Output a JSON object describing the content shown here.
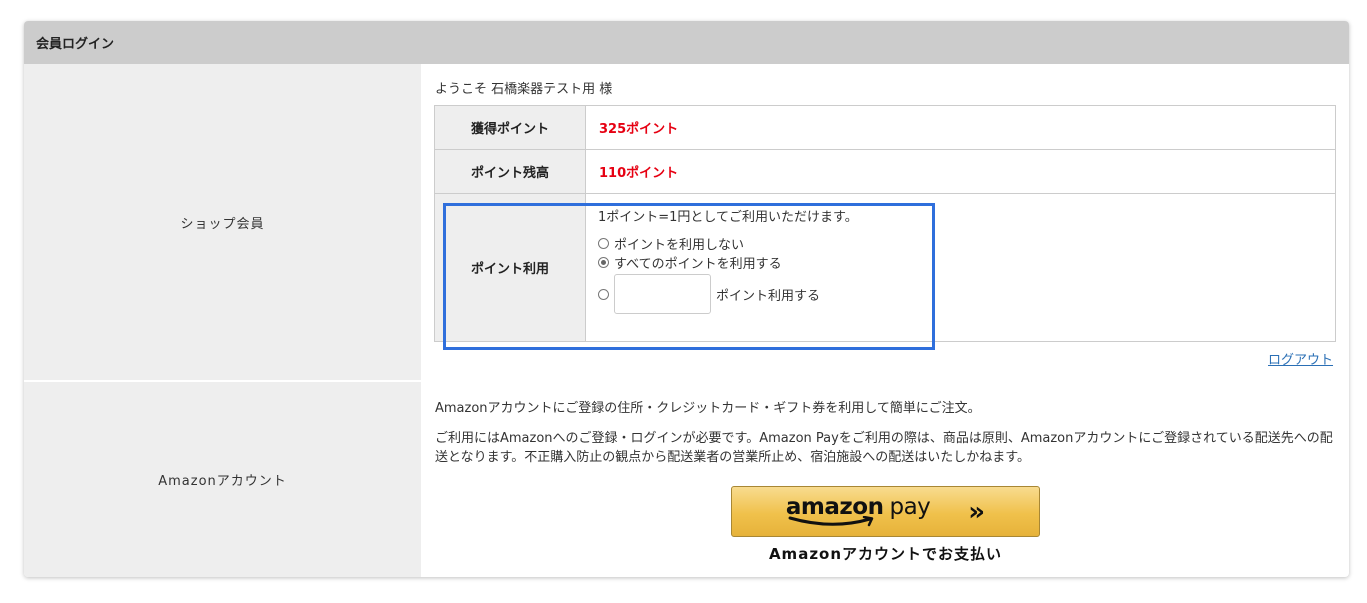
{
  "header": {
    "title": "会員ログイン"
  },
  "shop_member": {
    "label": "ショップ会員",
    "welcome": "ようこそ 石橋楽器テスト用 様",
    "earned_points_label": "獲得ポイント",
    "earned_points_value": "325ポイント",
    "balance_label": "ポイント残高",
    "balance_value": "110ポイント",
    "use_label": "ポイント利用",
    "use_note": "1ポイント=1円としてご利用いただけます。",
    "options": [
      {
        "label": "ポイントを利用しない",
        "checked": false
      },
      {
        "label": "すべてのポイントを利用する",
        "checked": true
      },
      {
        "label": "ポイント利用する",
        "checked": false
      }
    ],
    "amount_input_value": "",
    "logout_label": "ログアウト"
  },
  "amazon": {
    "label": "Amazonアカウント",
    "desc1": "Amazonアカウントにご登録の住所・クレジットカード・ギフト券を利用して簡単にご注文。",
    "desc2": "ご利用にはAmazonへのご登録・ログインが必要です。Amazon Payをご利用の際は、商品は原則、Amazonアカウントにご登録されている配送先への配送となります。不正購入防止の観点から配送業者の営業所止め、宿泊施設への配送はいたしかねます。",
    "button_logo_main": "amazon",
    "button_logo_pay": "pay",
    "button_caption": "Amazonアカウントでお支払い"
  },
  "colors": {
    "accent_red": "#e60012",
    "highlight_blue": "#2f6fdc",
    "link_blue": "#2a6fb5",
    "amazon_yellow": "#f0c14b"
  },
  "icons": {
    "pay_chevron": "double-chevron-right-icon",
    "smile": "amazon-smile-icon"
  }
}
